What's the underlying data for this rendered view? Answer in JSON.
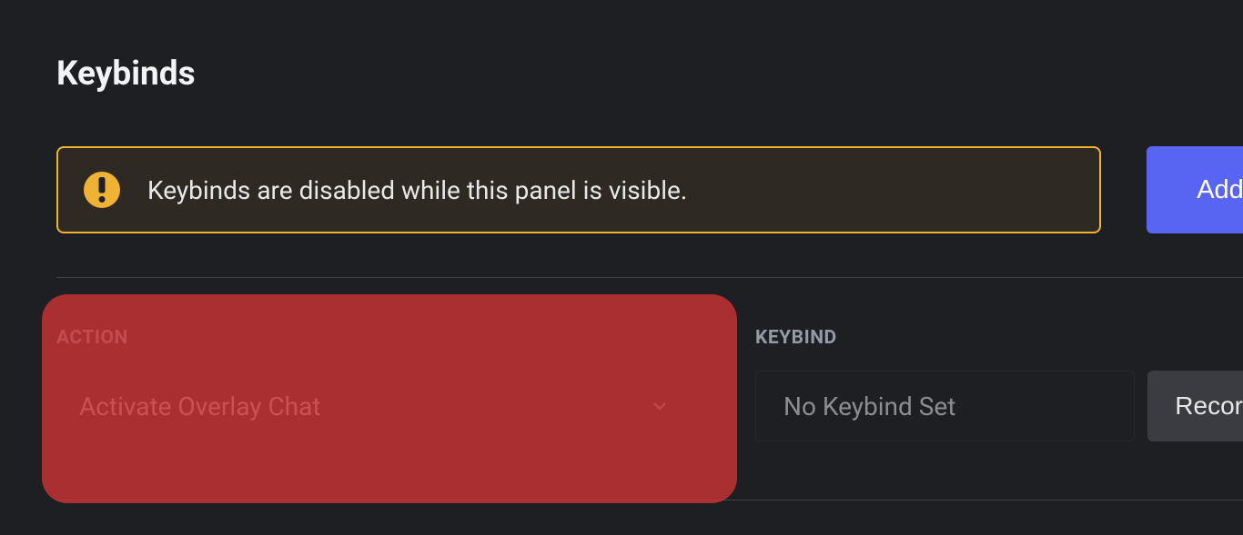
{
  "page": {
    "title": "Keybinds"
  },
  "warning": {
    "message": "Keybinds are disabled while this panel is visible."
  },
  "buttons": {
    "add": "Add",
    "record": "Recor"
  },
  "columns": {
    "action_label": "ACTION",
    "keybind_label": "KEYBIND"
  },
  "row": {
    "action_value": "Activate Overlay Chat",
    "keybind_value": "No Keybind Set"
  }
}
